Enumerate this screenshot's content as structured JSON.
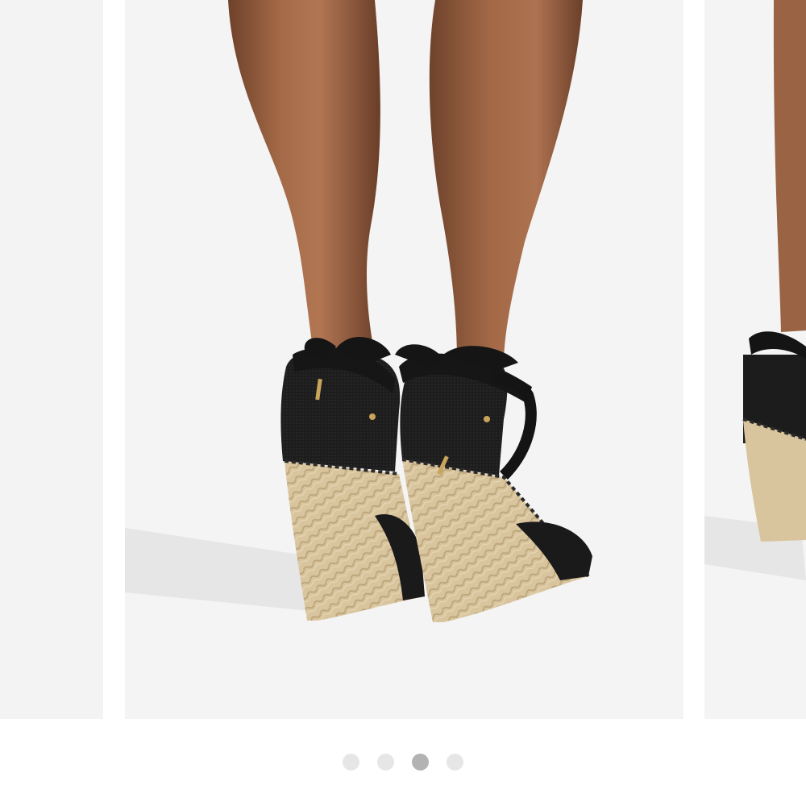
{
  "gallery": {
    "image_subject": "black-espadrille-wedge-sandals-on-model",
    "slide_count": 4,
    "active_index": 2,
    "colors": {
      "background": "#f4f4f4",
      "dot_inactive": "#e6e6e6",
      "dot_active": "#b3b3b3",
      "sandal_black": "#1c1c1c",
      "jute": "#d6c29a",
      "skin": "#9b6443"
    }
  }
}
